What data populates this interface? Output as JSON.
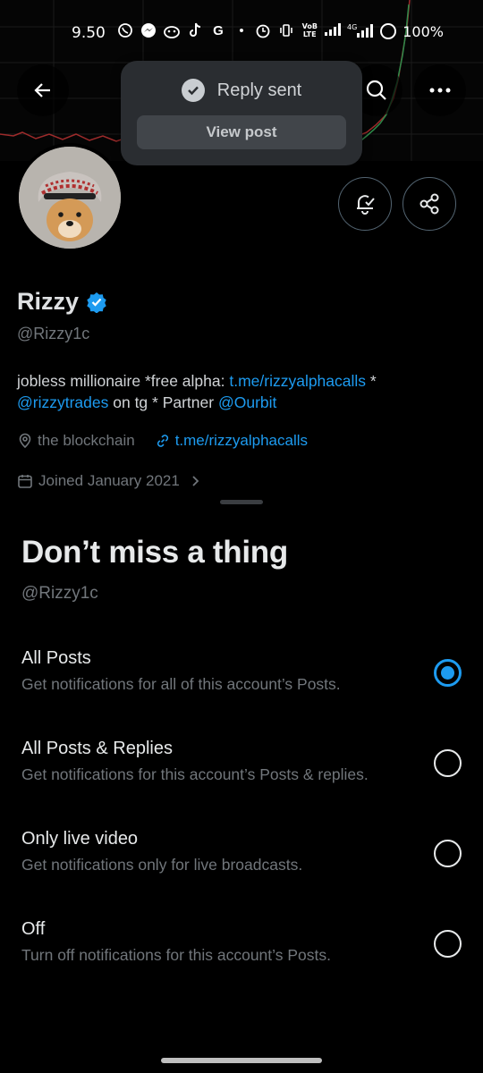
{
  "status_bar": {
    "time": "9.50",
    "battery": "100%",
    "network": "4G",
    "icons_left": [
      "whatsapp-icon",
      "messenger-icon",
      "reddit-icon",
      "tiktok-icon",
      "google-icon",
      "dot-icon"
    ],
    "icons_right": [
      "alarm-icon",
      "vibrate-icon",
      "volte-icon",
      "signal-icon",
      "signal-4g-icon",
      "battery-icon"
    ]
  },
  "toast": {
    "message": "Reply sent",
    "button_label": "View post"
  },
  "profile": {
    "name": "Rizzy",
    "handle": "@Rizzy1c",
    "bio": {
      "part1": "jobless millionaire *free alpha: ",
      "link1": "t.me/rizzyalphacalls",
      "part2": " *",
      "mention1": "@rizzytrades",
      "part3": " on tg * Partner ",
      "mention2": "@Ourbit"
    },
    "location": "the blockchain",
    "website": "t.me/rizzyalphacalls",
    "joined": "Joined January 2021"
  },
  "sheet": {
    "title": "Don’t miss a thing",
    "handle": "@Rizzy1c",
    "options": [
      {
        "title": "All Posts",
        "desc": "Get notifications for all of this account’s Posts.",
        "selected": true
      },
      {
        "title": "All Posts & Replies",
        "desc": "Get notifications for this account’s Posts & replies.",
        "selected": false
      },
      {
        "title": "Only live video",
        "desc": "Get notifications only for live broadcasts.",
        "selected": false
      },
      {
        "title": "Off",
        "desc": "Turn off notifications for this account’s Posts.",
        "selected": false
      }
    ]
  },
  "colors": {
    "accent": "#1d9bf0",
    "background": "#000000",
    "muted_text": "#71767b"
  }
}
